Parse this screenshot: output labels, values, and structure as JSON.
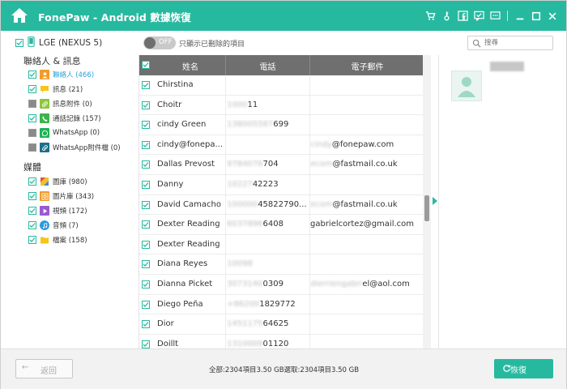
{
  "titlebar": {
    "title": "FonePaw - Android 數據恢復",
    "icons": [
      "home-icon",
      "cart-icon",
      "key-icon",
      "facebook-icon",
      "feedback-icon",
      "chat-icon",
      "minimize-icon",
      "maximize-icon",
      "close-icon"
    ],
    "color": "#27b9a0"
  },
  "sidebar": {
    "device": "LGE (NEXUS 5)",
    "section1": "聯絡人 & 訊息",
    "section1_items": [
      {
        "label": "聯絡人 (466)",
        "icon": "contacts-icon",
        "active": true,
        "checked": true
      },
      {
        "label": "訊息 (21)",
        "icon": "message-icon",
        "active": false,
        "checked": true
      },
      {
        "label": "訊息附件 (0)",
        "icon": "attachment-icon",
        "active": false,
        "checked": false
      },
      {
        "label": "通話記錄 (157)",
        "icon": "call-log-icon",
        "active": false,
        "checked": true
      },
      {
        "label": "WhatsApp (0)",
        "icon": "whatsapp-icon",
        "active": false,
        "checked": false
      },
      {
        "label": "WhatsApp附件檔 (0)",
        "icon": "whatsapp-attachment-icon",
        "active": false,
        "checked": false
      }
    ],
    "section2": "媒體",
    "section2_items": [
      {
        "label": "圖庫 (980)",
        "icon": "gallery-icon",
        "checked": true
      },
      {
        "label": "圖片庫 (343)",
        "icon": "picture-library-icon",
        "checked": true
      },
      {
        "label": "視頻 (172)",
        "icon": "video-icon",
        "checked": true
      },
      {
        "label": "音頻 (7)",
        "icon": "audio-icon",
        "checked": true
      },
      {
        "label": "檔案 (158)",
        "icon": "document-icon",
        "checked": true
      }
    ]
  },
  "toolbar": {
    "toggle_text": "OFF",
    "toggle_label": "只顯示已刪除的項目",
    "search_placeholder": "搜尋"
  },
  "table": {
    "headers": [
      "姓名",
      "電話",
      "電子郵件"
    ],
    "rows": [
      {
        "name": "Chirstina",
        "phone": "",
        "email": "",
        "phone_blur": "",
        "email_blur": ""
      },
      {
        "name": "Choitr",
        "phone": "11",
        "email": "",
        "phone_blur": "1000",
        "email_blur": ""
      },
      {
        "name": "cindy Green",
        "phone": "699",
        "email": "",
        "phone_blur": "138005587",
        "email_blur": ""
      },
      {
        "name": "cindy@fonepa...",
        "phone": "",
        "email": "@fonepaw.com",
        "phone_blur": "",
        "email_blur": "cindy"
      },
      {
        "name": "Dallas Prevost",
        "phone": "704",
        "email": "@fastmail.co.uk",
        "phone_blur": "9784076",
        "email_blur": "ecom"
      },
      {
        "name": "Danny",
        "phone": "42223",
        "email": "",
        "phone_blur": "10227",
        "email_blur": ""
      },
      {
        "name": "David Camacho",
        "phone": "45822790...",
        "email": "@fastmail.co.uk",
        "phone_blur": "100000",
        "email_blur": "ecom"
      },
      {
        "name": "Dexter Reading",
        "phone": "6408",
        "email": "gabrielcortez@gmail.com",
        "phone_blur": "6037896",
        "email_blur": ""
      },
      {
        "name": "Dexter Reading",
        "phone": "",
        "email": "",
        "phone_blur": "",
        "email_blur": ""
      },
      {
        "name": "Diana Reyes",
        "phone": "",
        "email": "",
        "phone_blur": "10098",
        "email_blur": ""
      },
      {
        "name": "Dianna Picket",
        "phone": "0309",
        "email": "el@aol.com",
        "phone_blur": "3073140",
        "email_blur": "dierriengabri"
      },
      {
        "name": "Diego Peña",
        "phone": "1829772",
        "email": "",
        "phone_blur": "+86200",
        "email_blur": ""
      },
      {
        "name": "Dior",
        "phone": "64625",
        "email": "",
        "phone_blur": "1451175",
        "email_blur": ""
      },
      {
        "name": "Doillt",
        "phone": "01120",
        "email": "",
        "phone_blur": "1310009",
        "email_blur": ""
      }
    ]
  },
  "bottombar": {
    "back_label": "返回",
    "summary": "全部:2304項目3.50 GB選取:2304項目3.50 GB",
    "restore_label": "恢復"
  }
}
